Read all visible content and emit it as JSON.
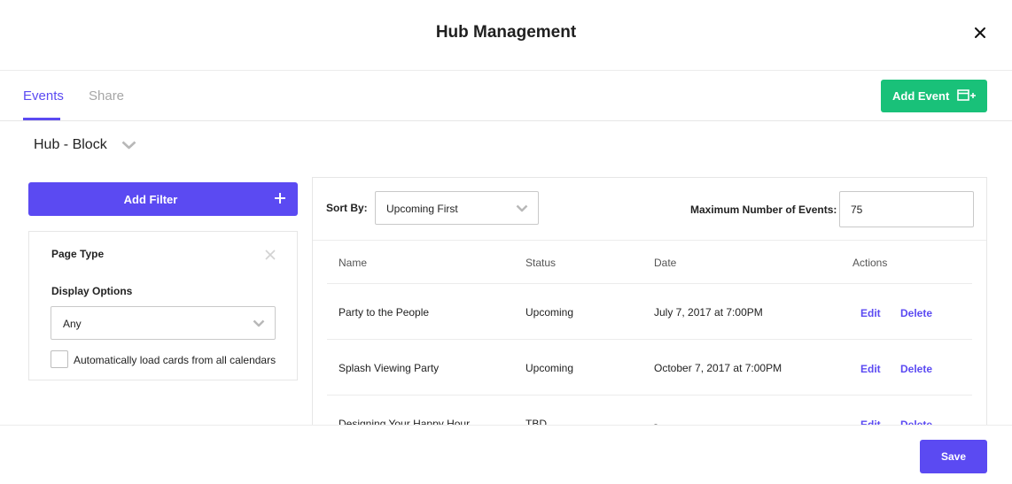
{
  "modal": {
    "title": "Hub Management"
  },
  "tabs": [
    {
      "label": "Events",
      "active": true
    },
    {
      "label": "Share",
      "active": false
    }
  ],
  "add_event_button": {
    "label": "Add Event",
    "icon": "calendar-plus-icon",
    "color": "#19c179"
  },
  "hub_selector": {
    "value": "Hub - Block"
  },
  "filters": {
    "add_filter_label": "Add Filter",
    "card": {
      "title": "Page Type",
      "display_options_label": "Display Options",
      "display_value": "Any",
      "auto_load_label": "Automatically load cards from all calendars",
      "auto_load_checked": false
    }
  },
  "events": {
    "sort_label": "Sort By:",
    "sort_value": "Upcoming First",
    "max_label": "Maximum Number of Events:",
    "max_value": "75",
    "columns": [
      "Name",
      "Status",
      "Date",
      "Actions"
    ],
    "rows": [
      {
        "name": "Party to the People",
        "status": "Upcoming",
        "date": "July 7, 2017 at 7:00PM",
        "edit": "Edit",
        "delete": "Delete"
      },
      {
        "name": "Splash Viewing Party",
        "status": "Upcoming",
        "date": "October 7, 2017 at 7:00PM",
        "edit": "Edit",
        "delete": "Delete"
      },
      {
        "name": "Designing Your Happy Hour",
        "status": "TBD",
        "date": "-",
        "edit": "Edit",
        "delete": "Delete"
      }
    ]
  },
  "footer": {
    "save_label": "Save"
  },
  "colors": {
    "primary": "#5b4af2",
    "success": "#19c179"
  }
}
